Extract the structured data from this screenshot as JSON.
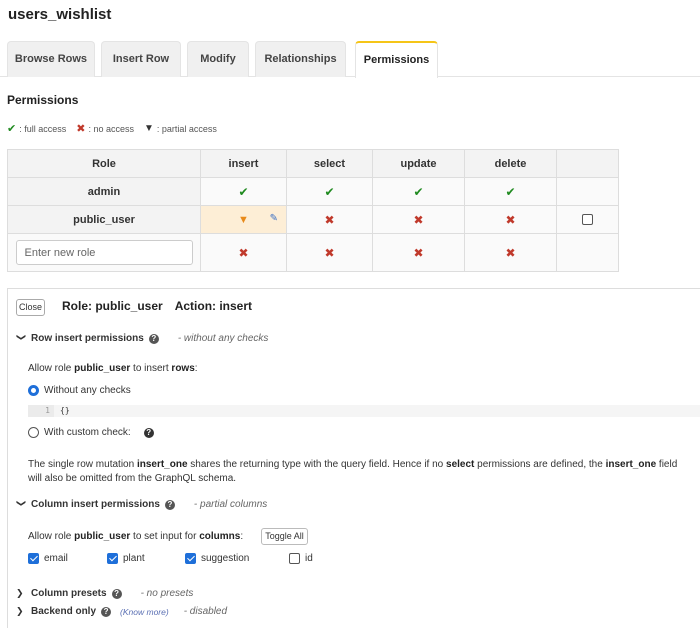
{
  "page": {
    "title": "users_wishlist"
  },
  "tabs": [
    {
      "label": "Browse Rows",
      "active": false
    },
    {
      "label": "Insert Row",
      "active": false
    },
    {
      "label": "Modify",
      "active": false
    },
    {
      "label": "Relationships",
      "active": false
    },
    {
      "label": "Permissions",
      "active": true
    }
  ],
  "permissions": {
    "heading": "Permissions",
    "legend": {
      "full": ": full access",
      "none": ": no access",
      "partial": ": partial access"
    },
    "columns": [
      "Role",
      "insert",
      "select",
      "update",
      "delete"
    ],
    "rows": [
      {
        "role": "admin",
        "insert": "full",
        "select": "full",
        "update": "full",
        "delete": "full"
      },
      {
        "role": "public_user",
        "insert": "partial",
        "select": "none",
        "update": "none",
        "delete": "none"
      }
    ],
    "new_role_placeholder": "Enter new role"
  },
  "editor": {
    "close_label": "Close",
    "role_label": "Role: public_user",
    "action_label": "Action: insert",
    "row_section": {
      "title": "Row insert permissions",
      "note": "- without any checks",
      "allow_pre": "Allow role ",
      "allow_role": "public_user",
      "allow_mid": " to insert ",
      "allow_obj": "rows",
      "allow_end": ":",
      "option_without": "Without any checks",
      "option_custom": "With custom check:",
      "code_line_no": "1",
      "code": "{}"
    },
    "mutation_note": {
      "p1": "The single row mutation ",
      "b1": "insert_one",
      "p2": " shares the returning type with the query field. Hence if no ",
      "b2": "select",
      "p3": " permissions are defined, the ",
      "b3": "insert_one",
      "p4": " field",
      "line2": "will also be omitted from the GraphQL schema."
    },
    "column_section": {
      "title": "Column insert permissions",
      "note": "- partial columns",
      "allow_pre": "Allow role ",
      "allow_role": "public_user",
      "allow_mid": " to set input for ",
      "allow_obj": "columns",
      "allow_end": ":",
      "toggle_all": "Toggle All",
      "columns": [
        {
          "name": "email",
          "checked": true
        },
        {
          "name": "plant",
          "checked": true
        },
        {
          "name": "suggestion",
          "checked": true
        },
        {
          "name": "id",
          "checked": false
        }
      ]
    },
    "presets_section": {
      "title": "Column presets",
      "note": "- no presets"
    },
    "backend_section": {
      "title": "Backend only",
      "know_more": "(Know more)",
      "note": "- disabled"
    }
  },
  "colors": {
    "accent": "#f5c518",
    "full": "#1f8a1f",
    "none": "#c0392b",
    "checkbox": "#1e6fd9"
  }
}
